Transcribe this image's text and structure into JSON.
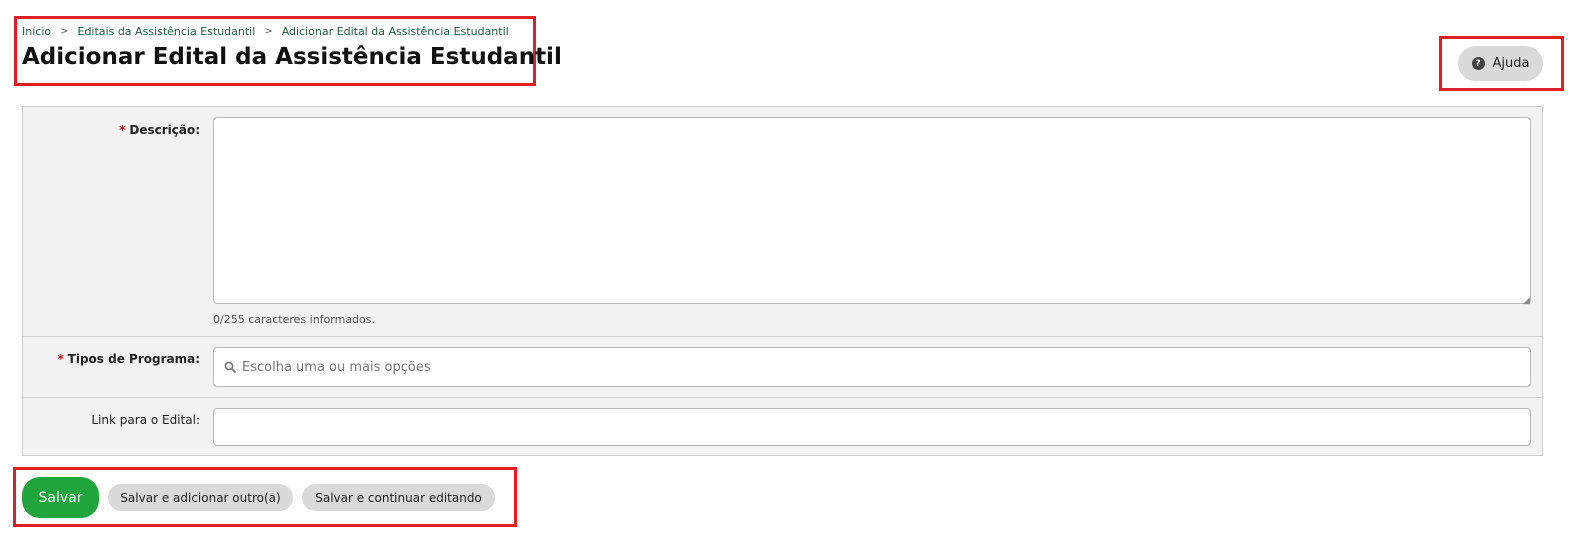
{
  "breadcrumb": {
    "items": [
      "Início",
      "Editais da Assistência Estudantil",
      "Adicionar Edital da Assistência Estudantil"
    ],
    "separator": ">"
  },
  "page": {
    "title": "Adicionar Edital da Assistência Estudantil"
  },
  "help": {
    "label": "Ajuda",
    "icon": "question-circle-icon"
  },
  "form": {
    "descricao": {
      "label": "Descrição:",
      "required_mark": "*",
      "value": "",
      "counter": "0/255 caracteres informados."
    },
    "tipos_programa": {
      "label": "Tipos de Programa:",
      "required_mark": "*",
      "placeholder": "Escolha uma ou mais opções",
      "icon": "search-icon"
    },
    "link_edital": {
      "label": "Link para o Edital:",
      "value": ""
    }
  },
  "actions": {
    "save": "Salvar",
    "save_add": "Salvar e adicionar outro(a)",
    "save_continue": "Salvar e continuar editando"
  },
  "colors": {
    "primary": "#1fa53c",
    "highlight": "#e02020",
    "link": "#1d5d3e",
    "required": "#c0121a"
  }
}
